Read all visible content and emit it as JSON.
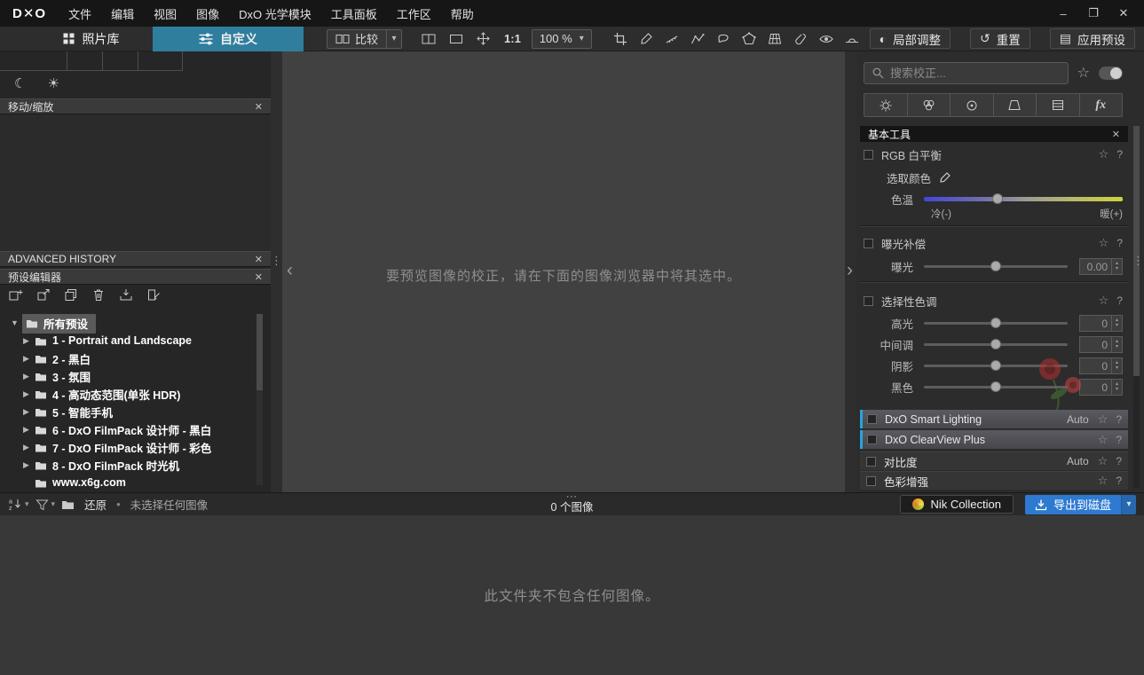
{
  "colors": {
    "active_tab": "#2f7e9e",
    "export_button": "#2e7ad1",
    "highlight_edge": "#2aa2dd",
    "temp_cold": "#4446d6",
    "temp_warm": "#ccd23e"
  },
  "glyphs": {
    "dropdown": "▾",
    "step_up": "▴",
    "step_down": "▾",
    "star": "☆",
    "help": "?",
    "chevron_left": "‹",
    "chevron_right": "›",
    "v_handle": "⋮",
    "h_handle": "⋯",
    "expand": "▶",
    "collapse": "▼",
    "bullet": "•",
    "night": "☾",
    "day": "☀",
    "local_adjust": "◐",
    "reset": "↺",
    "presets": "▤",
    "minimize": "–",
    "maximize": "❐",
    "close": "✕"
  },
  "titlebar": {
    "logo": "D✕O",
    "menus": [
      "文件",
      "编辑",
      "视图",
      "图像",
      "DxO 光学模块",
      "工具面板",
      "工作区",
      "帮助"
    ]
  },
  "toolbar": {
    "tab_photolibrary": "照片库",
    "tab_customize": "自定义",
    "compare": "比较",
    "one_to_one": "1:1",
    "zoom": "100 %",
    "local_adjust": "局部调整",
    "reset": "重置",
    "apply_preset": "应用预设"
  },
  "left_panel": {
    "move_zoom_title": "移动/缩放",
    "history_title": "ADVANCED HISTORY",
    "preset_editor_title": "预设编辑器",
    "tree_root": "所有预设",
    "tree_items": [
      "1 - Portrait and Landscape",
      "2 - 黑白",
      "3 - 氛围",
      "4 - 高动态范围(单张 HDR)",
      "5 - 智能手机",
      "6 - DxO FilmPack 设计师 - 黑白",
      "7 - DxO FilmPack 设计师 - 彩色",
      "8 - DxO FilmPack 时光机",
      "www.x6g.com"
    ]
  },
  "viewer": {
    "message": "要预览图像的校正，请在下面的图像浏览器中将其选中。"
  },
  "right_panel": {
    "search_placeholder": "搜索校正...",
    "fx_label": "fx",
    "basic_tools_title": "基本工具",
    "white_balance": {
      "title": "RGB 白平衡",
      "pick_color": "选取颜色",
      "temp": "色温",
      "cold": "冷(-)",
      "warm": "暖(+)"
    },
    "exposure": {
      "title": "曝光补偿",
      "label": "曝光",
      "value": "0.00"
    },
    "selective_tone": {
      "title": "选择性色调",
      "sliders": [
        {
          "label": "高光",
          "value": "0"
        },
        {
          "label": "中间调",
          "value": "0"
        },
        {
          "label": "阴影",
          "value": "0"
        },
        {
          "label": "黑色",
          "value": "0"
        }
      ]
    },
    "smart_lighting": {
      "title": "DxO Smart Lighting",
      "badge": "Auto"
    },
    "clearview": {
      "title": "DxO ClearView Plus"
    },
    "contrast": {
      "title": "对比度",
      "badge": "Auto"
    },
    "color_enhance": {
      "title": "色彩增强"
    }
  },
  "status_bar": {
    "restore": "还原",
    "no_selection": "未选择任何图像",
    "image_count": "0 个图像",
    "nik": "Nik Collection",
    "export": "导出到磁盘"
  },
  "browser": {
    "empty_message": "此文件夹不包含任何图像。"
  }
}
